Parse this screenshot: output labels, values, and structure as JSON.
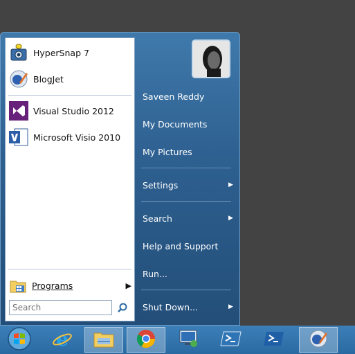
{
  "start_menu": {
    "pinned": [
      {
        "label": "HyperSnap 7",
        "icon": "camera-icon"
      },
      {
        "label": "BlogJet",
        "icon": "blogjet-icon"
      }
    ],
    "recent": [
      {
        "label": "Visual Studio 2012",
        "icon": "visual-studio-icon"
      },
      {
        "label": "Microsoft Visio 2010",
        "icon": "visio-icon"
      }
    ],
    "programs_label": "Programs",
    "search_placeholder": "Search",
    "right_items": [
      {
        "label": "Saveen Reddy"
      },
      {
        "label": "My Documents"
      },
      {
        "label": "My Pictures"
      },
      {
        "label": "Settings",
        "submenu": true
      },
      {
        "label": "Search",
        "submenu": true
      },
      {
        "label": "Help and Support"
      },
      {
        "label": "Run..."
      },
      {
        "label": "Shut Down...",
        "submenu": true
      }
    ]
  },
  "taskbar": {
    "buttons": [
      "start-orb-icon",
      "internet-explorer-icon",
      "file-explorer-icon",
      "chrome-icon",
      "remote-desktop-icon",
      "powershell-icon",
      "powershell-icon",
      "blogjet-icon"
    ],
    "active": [
      "file-explorer-icon",
      "chrome-icon",
      "blogjet-icon"
    ]
  }
}
